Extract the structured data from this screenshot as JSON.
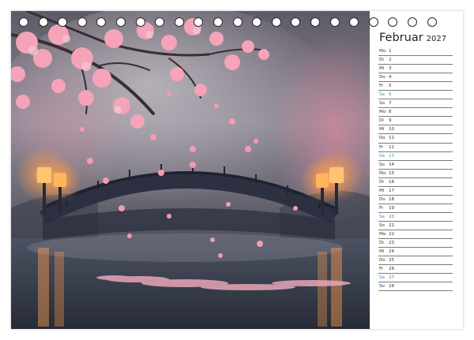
{
  "calendar": {
    "month": "Februar",
    "year": "2027",
    "days": [
      {
        "wd": "Mo",
        "n": "1"
      },
      {
        "wd": "Di",
        "n": "2"
      },
      {
        "wd": "Mi",
        "n": "3"
      },
      {
        "wd": "Do",
        "n": "4"
      },
      {
        "wd": "Fr",
        "n": "5"
      },
      {
        "wd": "Sa",
        "n": "6"
      },
      {
        "wd": "So",
        "n": "7"
      },
      {
        "wd": "Mo",
        "n": "8"
      },
      {
        "wd": "Di",
        "n": "9"
      },
      {
        "wd": "Mi",
        "n": "10"
      },
      {
        "wd": "Do",
        "n": "11"
      },
      {
        "wd": "Fr",
        "n": "12"
      },
      {
        "wd": "Sa",
        "n": "13"
      },
      {
        "wd": "So",
        "n": "14"
      },
      {
        "wd": "Mo",
        "n": "15"
      },
      {
        "wd": "Di",
        "n": "16"
      },
      {
        "wd": "Mi",
        "n": "17"
      },
      {
        "wd": "Do",
        "n": "18"
      },
      {
        "wd": "Fr",
        "n": "19"
      },
      {
        "wd": "Sa",
        "n": "20"
      },
      {
        "wd": "So",
        "n": "21"
      },
      {
        "wd": "Mo",
        "n": "22"
      },
      {
        "wd": "Di",
        "n": "23"
      },
      {
        "wd": "Mi",
        "n": "24"
      },
      {
        "wd": "Do",
        "n": "25"
      },
      {
        "wd": "Fr",
        "n": "26"
      },
      {
        "wd": "Sa",
        "n": "27"
      },
      {
        "wd": "So",
        "n": "28"
      }
    ]
  },
  "colors": {
    "saturday": "#3a8fb5",
    "blossom": "#f4a3b8",
    "lantern": "#ffb35a"
  },
  "binding": {
    "ring_count": 22
  }
}
